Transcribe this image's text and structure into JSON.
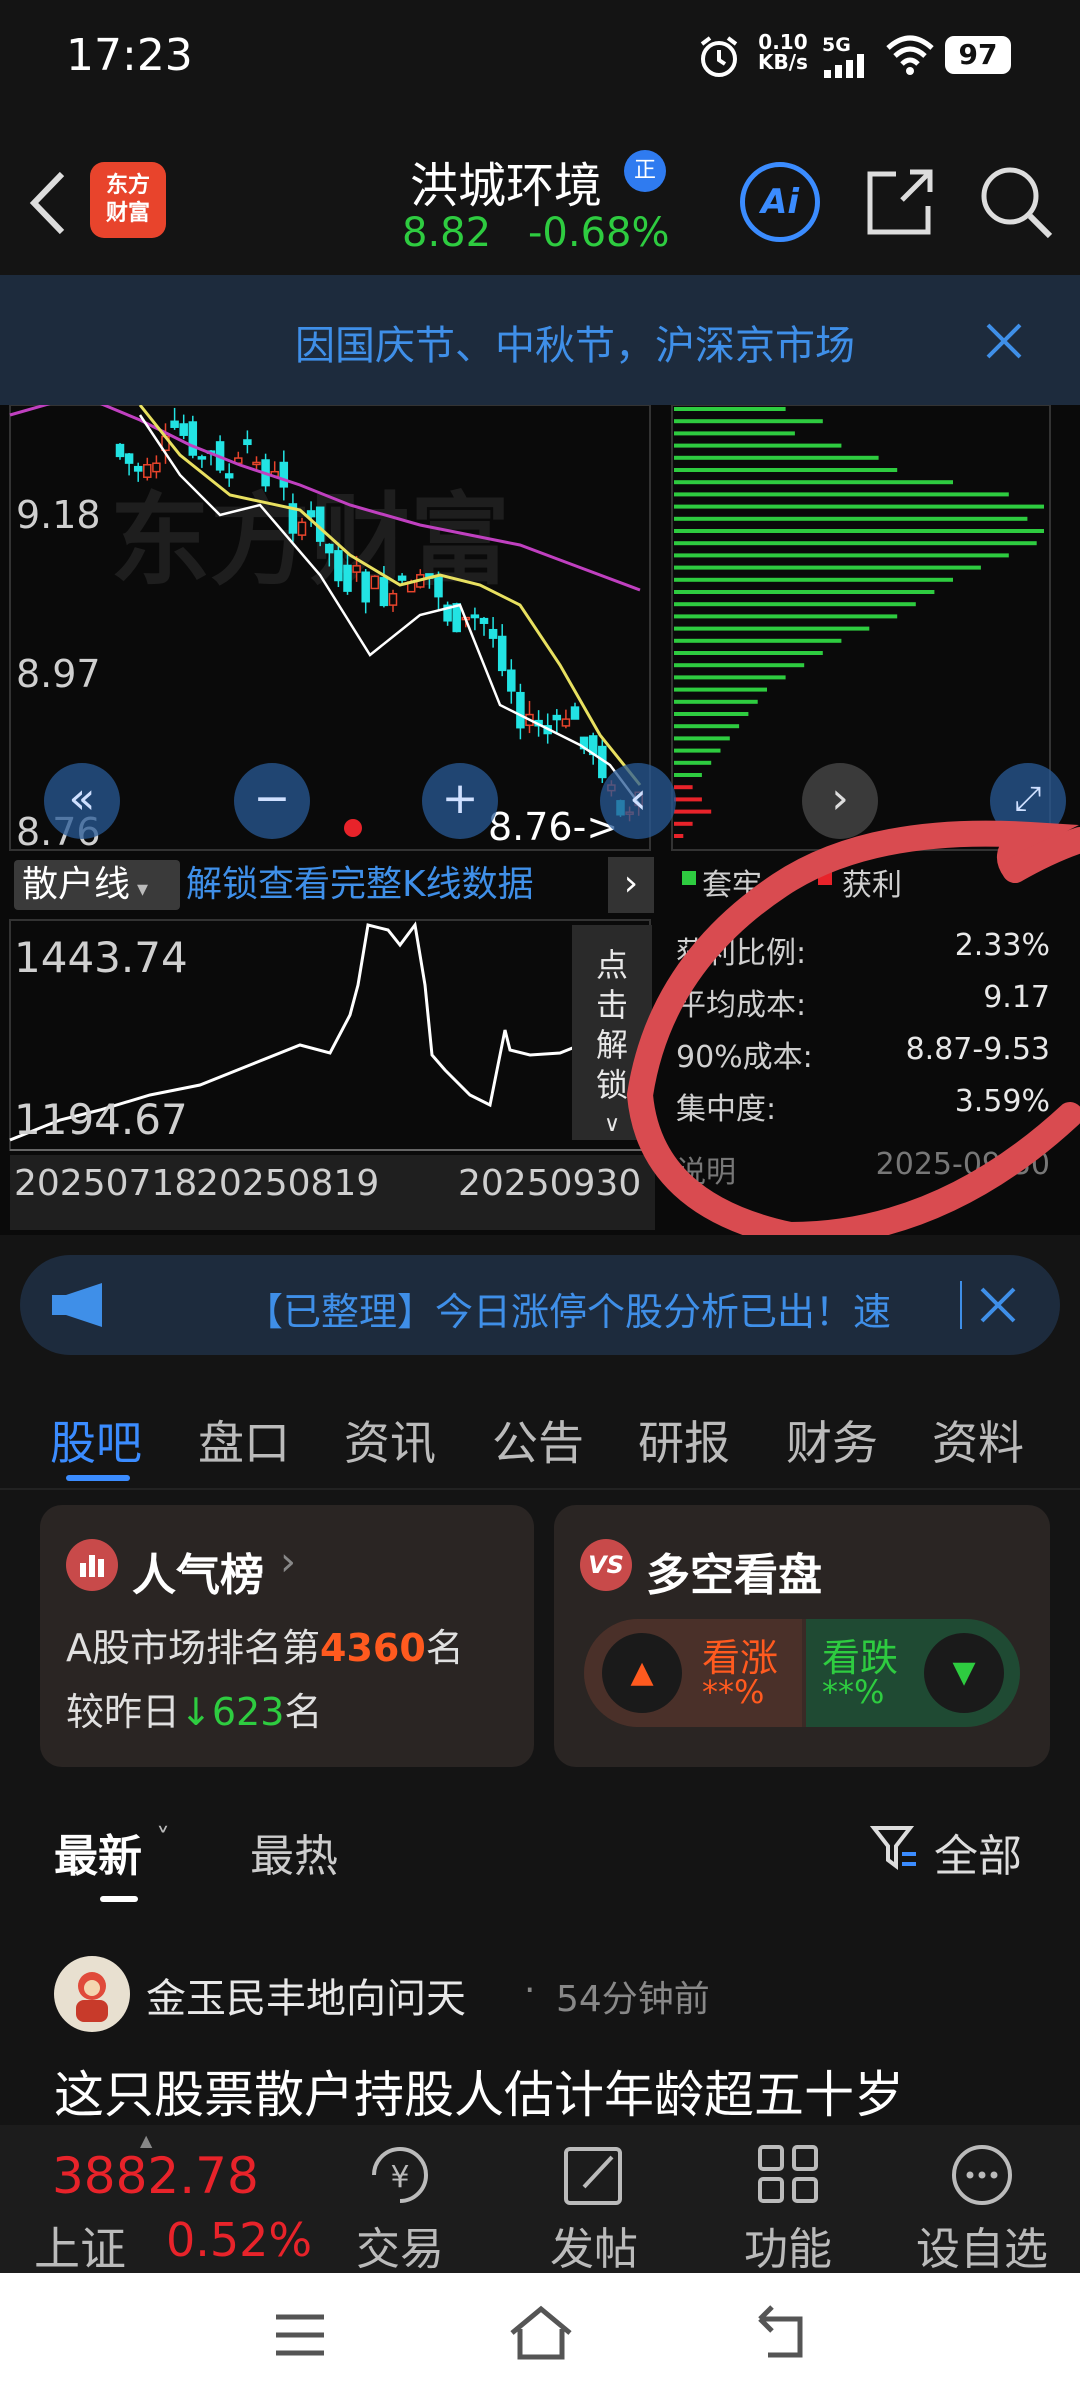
{
  "status": {
    "time": "17:23",
    "net_speed_value": "0.10",
    "net_speed_unit": "KB/s",
    "network": "5G",
    "battery": "97"
  },
  "header": {
    "logo_line1": "东方",
    "logo_line2": "财富",
    "stock_name": "洪城环境",
    "badge": "正",
    "price": "8.82",
    "change_pct": "-0.68%",
    "ai_label": "Ai"
  },
  "notice": {
    "text": "因国庆节、中秋节，沪深京市场"
  },
  "kline": {
    "price_labels": [
      "9.18",
      "8.97",
      "8.76"
    ],
    "current_marker": "8.76->",
    "watermark": "东方财富",
    "indicator_select": "散户线",
    "unlock_text": "解锁查看完整K线数据",
    "click_unlock": [
      "点",
      "击",
      "解",
      "锁"
    ],
    "sub_max": "1443.74",
    "sub_min": "1194.67",
    "dates": [
      "20250718",
      "20250819",
      "20250930"
    ]
  },
  "chip": {
    "legend_trapped": "套牢",
    "legend_profit": "获利",
    "rows": [
      {
        "label": "获利比例:",
        "value": "2.33%"
      },
      {
        "label": "平均成本:",
        "value": "9.17"
      },
      {
        "label": "90%成本:",
        "value": "8.87-9.53"
      },
      {
        "label": "集中度:",
        "value": "3.59%"
      }
    ],
    "explain_label": "说明",
    "date": "2025-09-30"
  },
  "ticker": {
    "text": "【已整理】今日涨停个股分析已出！速"
  },
  "tabs": [
    "股吧",
    "盘口",
    "资讯",
    "公告",
    "研报",
    "财务",
    "资料"
  ],
  "popularity": {
    "title": "人气榜",
    "rank_prefix": "A股市场排名第",
    "rank": "4360",
    "rank_suffix": "名",
    "change_prefix": "较昨日",
    "change": "623",
    "change_suffix": "名"
  },
  "sentiment": {
    "title": "多空看盘",
    "bull_label": "看涨",
    "bull_value": "**%",
    "bear_label": "看跌",
    "bear_value": "**%"
  },
  "feed": {
    "tab_latest": "最新",
    "tab_hot": "最热",
    "filter": "全部",
    "author": "金玉民丰地向问天",
    "time_ago": "54分钟前",
    "title": "这只股票散户持股人估计年龄超五十岁"
  },
  "bottom": {
    "index_value": "3882.78",
    "index_name": "上证",
    "index_change": "0.52%",
    "items": [
      "交易",
      "发帖",
      "功能",
      "设自选"
    ]
  },
  "colors": {
    "up": "#e8442c",
    "down": "#2ecc40",
    "accent": "#3b8cff"
  }
}
